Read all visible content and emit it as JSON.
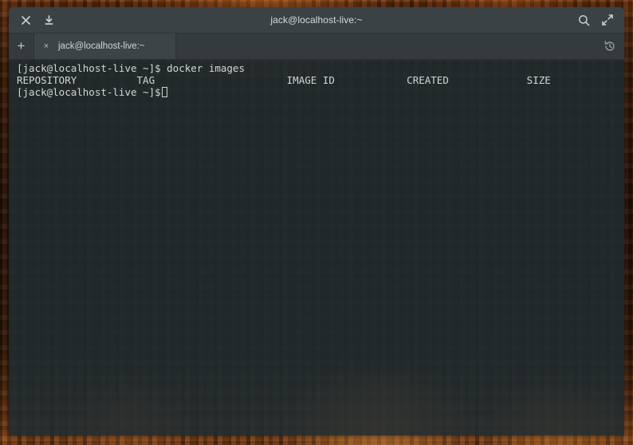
{
  "window": {
    "title": "jack@localhost-live:~",
    "titlebar_buttons": [
      {
        "name": "close-icon",
        "label": "×"
      },
      {
        "name": "download-icon",
        "label": "download"
      }
    ],
    "right_buttons": [
      {
        "name": "search-icon",
        "label": "search"
      },
      {
        "name": "maximize-icon",
        "label": "maximize"
      }
    ]
  },
  "tabbar": {
    "new_tab_label": "+",
    "tabs": [
      {
        "close_label": "×",
        "title": "jack@localhost-live:~",
        "active": true
      }
    ],
    "history_label": "history"
  },
  "terminal": {
    "prompt": "[jack@localhost-live ~]$",
    "lines": [
      "[jack@localhost-live ~]$ docker images",
      "REPOSITORY          TAG                      IMAGE ID            CREATED             SIZE",
      "[jack@localhost-live ~]$ "
    ],
    "command": "docker images",
    "table_headers": [
      "REPOSITORY",
      "TAG",
      "IMAGE ID",
      "CREATED",
      "SIZE"
    ],
    "table_rows": [],
    "cursor": "block-outline"
  },
  "colors": {
    "titlebar": "#3b4245",
    "tabbar": "#343a3d",
    "tab_active": "#3d4448",
    "terminal_bg": "#202b30",
    "terminal_fg": "#d2d6d4",
    "wallpaper_accent": "#97501b"
  }
}
